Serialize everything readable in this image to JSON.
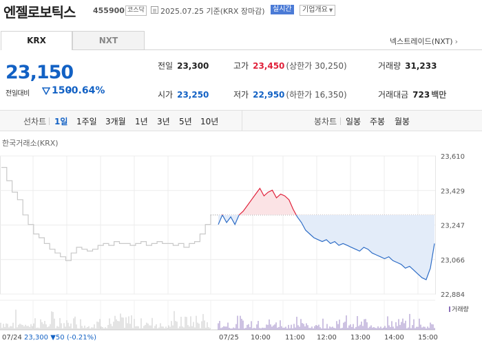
{
  "header": {
    "stock_name": "엔젤로보틱스",
    "stock_code": "455900",
    "market": "코스닥",
    "as_of": "2025.07.25 기준(KRX 장마감)",
    "realtime": "실시간",
    "company_button": "기업개요",
    "colors": {
      "accent": "#4b7bd6"
    }
  },
  "tabs": {
    "krx": "KRX",
    "nxt": "NXT",
    "nxt_link": "넥스트레이드(NXT)"
  },
  "quote": {
    "price": "23,150",
    "change_label": "전일대비",
    "change": "150",
    "change_pct": "-0.64%",
    "prev_close_label": "전일",
    "prev_close": "23,300",
    "open_label": "시가",
    "open": "23,250",
    "high_label": "고가",
    "high": "23,450",
    "upper_limit": "(상한가 30,250)",
    "low_label": "저가",
    "low": "22,950",
    "lower_limit": "(하한가 16,350)",
    "volume_label": "거래량",
    "volume": "31,233",
    "amount_label": "거래대금",
    "amount": "723",
    "amount_unit": "백만",
    "colors": {
      "up": "#e0213a",
      "down": "#1261c4"
    }
  },
  "periods": {
    "line_label": "선차트",
    "line_items": [
      "1일",
      "1주일",
      "3개월",
      "1년",
      "3년",
      "5년",
      "10년"
    ],
    "active": "1일",
    "candle_label": "봉차트",
    "candle_items": [
      "일봉",
      "주봉",
      "월봉"
    ]
  },
  "chart": {
    "source_label": "한국거래소(KRX)",
    "volume_label": "거래량",
    "prev_day": {
      "date": "07/24",
      "close": "23,300",
      "change": "▼50",
      "pct": "(-0.21%)"
    }
  },
  "chart_data": {
    "type": "line",
    "y_ticks": [
      "23,610",
      "23,429",
      "23,247",
      "23,066",
      "22,884"
    ],
    "ylim": [
      22884,
      23610
    ],
    "x_labels": [
      "07/24",
      "07/25",
      "10:00",
      "11:00",
      "12:00",
      "13:00",
      "14:00",
      "15:00"
    ],
    "reference_price": 23300,
    "series": [
      {
        "values_prev_day": [
          23550,
          23480,
          23420,
          23380,
          23300,
          23250,
          23200,
          23180,
          23150,
          23120,
          23100,
          23080,
          23060,
          23100,
          23130,
          23120,
          23110,
          23120,
          23140,
          23150,
          23140,
          23160,
          23150,
          23150,
          23140,
          23150,
          23160,
          23140,
          23150,
          23160,
          23150,
          23150,
          23140,
          23150,
          23130,
          23150,
          23160,
          23200,
          23250,
          23300
        ],
        "values_today": [
          23250,
          23300,
          23260,
          23290,
          23250,
          23300,
          23320,
          23350,
          23380,
          23410,
          23440,
          23400,
          23420,
          23430,
          23390,
          23410,
          23400,
          23380,
          23330,
          23290,
          23260,
          23220,
          23200,
          23180,
          23170,
          23160,
          23170,
          23150,
          23160,
          23140,
          23150,
          23140,
          23130,
          23120,
          23110,
          23130,
          23120,
          23100,
          23090,
          23080,
          23070,
          23080,
          23060,
          23050,
          23040,
          23020,
          23030,
          23010,
          22990,
          22970,
          22960,
          23020,
          23150
        ]
      }
    ]
  }
}
